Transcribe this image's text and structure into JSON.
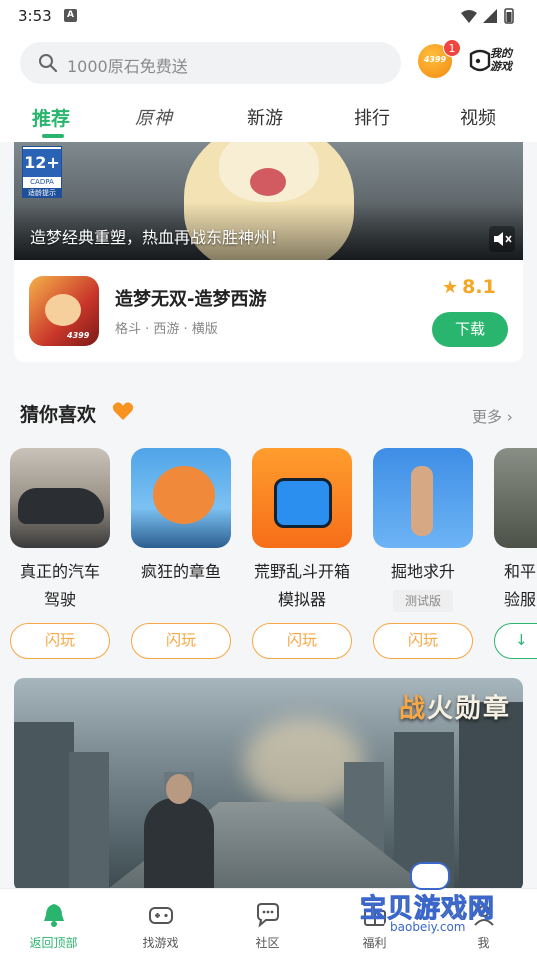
{
  "status_bar": {
    "time": "3:53",
    "notification_letter": "A"
  },
  "header": {
    "search_placeholder": "1000原石免费送",
    "brand_badge_text": "4399",
    "notification_count": "1",
    "my_games_label": "我的游戏"
  },
  "tabs": [
    {
      "label": "推荐",
      "active": true
    },
    {
      "label": "原神",
      "active": false
    },
    {
      "label": "新游",
      "active": false
    },
    {
      "label": "排行",
      "active": false
    },
    {
      "label": "视频",
      "active": false
    }
  ],
  "feature": {
    "age_rating": "12+",
    "age_org": "CADPA",
    "age_tip": "适龄提示",
    "video_caption": "造梦经典重塑，热血再战东胜神州！",
    "app_name": "造梦无双-造梦西游",
    "app_tags": "格斗 · 西游 · 横版",
    "app_icon_mark": "4399",
    "rating": "8.1",
    "download_label": "下载"
  },
  "guess_section": {
    "title": "猜你喜欢",
    "more_label": "更多",
    "games": [
      {
        "name": "真正的汽车驾驶",
        "button": "闪玩",
        "test_tag": ""
      },
      {
        "name": "疯狂的章鱼",
        "button": "闪玩",
        "test_tag": ""
      },
      {
        "name": "荒野乱斗开箱模拟器",
        "button": "闪玩",
        "test_tag": ""
      },
      {
        "name": "掘地求升",
        "button": "闪玩",
        "test_tag": "测试版"
      },
      {
        "name": "和平验服",
        "button": "↓",
        "test_tag": ""
      }
    ]
  },
  "banner": {
    "title_highlight": "战",
    "title_rest": "火勋章"
  },
  "bottom_nav": [
    {
      "label": "返回顶部",
      "active": true
    },
    {
      "label": "找游戏",
      "active": false
    },
    {
      "label": "社区",
      "active": false
    },
    {
      "label": "福利",
      "active": false
    },
    {
      "label": "我",
      "active": false
    }
  ],
  "watermark": {
    "title": "宝贝游戏网",
    "url": "baobeiy.com"
  },
  "colors": {
    "accent_green": "#2ab56e",
    "accent_orange": "#f7a746",
    "rating": "#f6a623"
  }
}
